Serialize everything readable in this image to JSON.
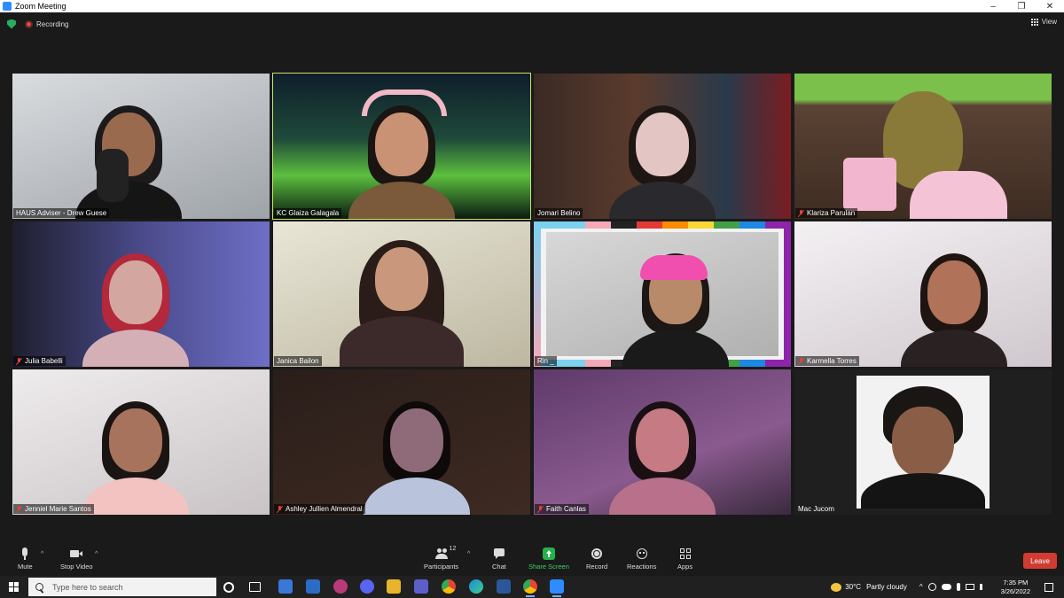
{
  "window": {
    "title": "Zoom Meeting",
    "controls": [
      "–",
      "❐",
      "✕"
    ]
  },
  "topbar": {
    "recording_label": "Recording",
    "view_label": "View"
  },
  "participants": [
    {
      "name": "HAUS Adviser - Drew Guese",
      "muted": false,
      "active": false
    },
    {
      "name": "KC Glaiza Galagala",
      "muted": false,
      "active": true
    },
    {
      "name": "Jomari Belino",
      "muted": false,
      "active": false
    },
    {
      "name": "Klariza Parulan",
      "muted": true,
      "active": false
    },
    {
      "name": "Julia Babelli",
      "muted": true,
      "active": false
    },
    {
      "name": "Janica Bailon",
      "muted": false,
      "active": false
    },
    {
      "name": "Rin _",
      "muted": false,
      "active": false
    },
    {
      "name": "Karmella Torres",
      "muted": true,
      "active": false
    },
    {
      "name": "Jenniel Marie Santos",
      "muted": true,
      "active": false
    },
    {
      "name": "Ashley Jullien Almendral",
      "muted": true,
      "active": false
    },
    {
      "name": "Faith Canlas",
      "muted": true,
      "active": false
    },
    {
      "name": "Mac Jucom",
      "muted": false,
      "active": false
    }
  ],
  "toolbar": {
    "mute": "Mute",
    "stop_video": "Stop Video",
    "participants": "Participants",
    "participants_count": "12",
    "chat": "Chat",
    "share_screen": "Share Screen",
    "record": "Record",
    "reactions": "Reactions",
    "apps": "Apps",
    "leave": "Leave"
  },
  "colors": {
    "share_green": "#23b34a",
    "leave_red": "#d13b32",
    "active_speaker": "#c7e36b"
  },
  "taskbar": {
    "search_placeholder": "Type here to search",
    "weather_temp": "30°C",
    "weather_desc": "Partly cloudy",
    "time": "7:35 PM",
    "date": "3/26/2022"
  }
}
